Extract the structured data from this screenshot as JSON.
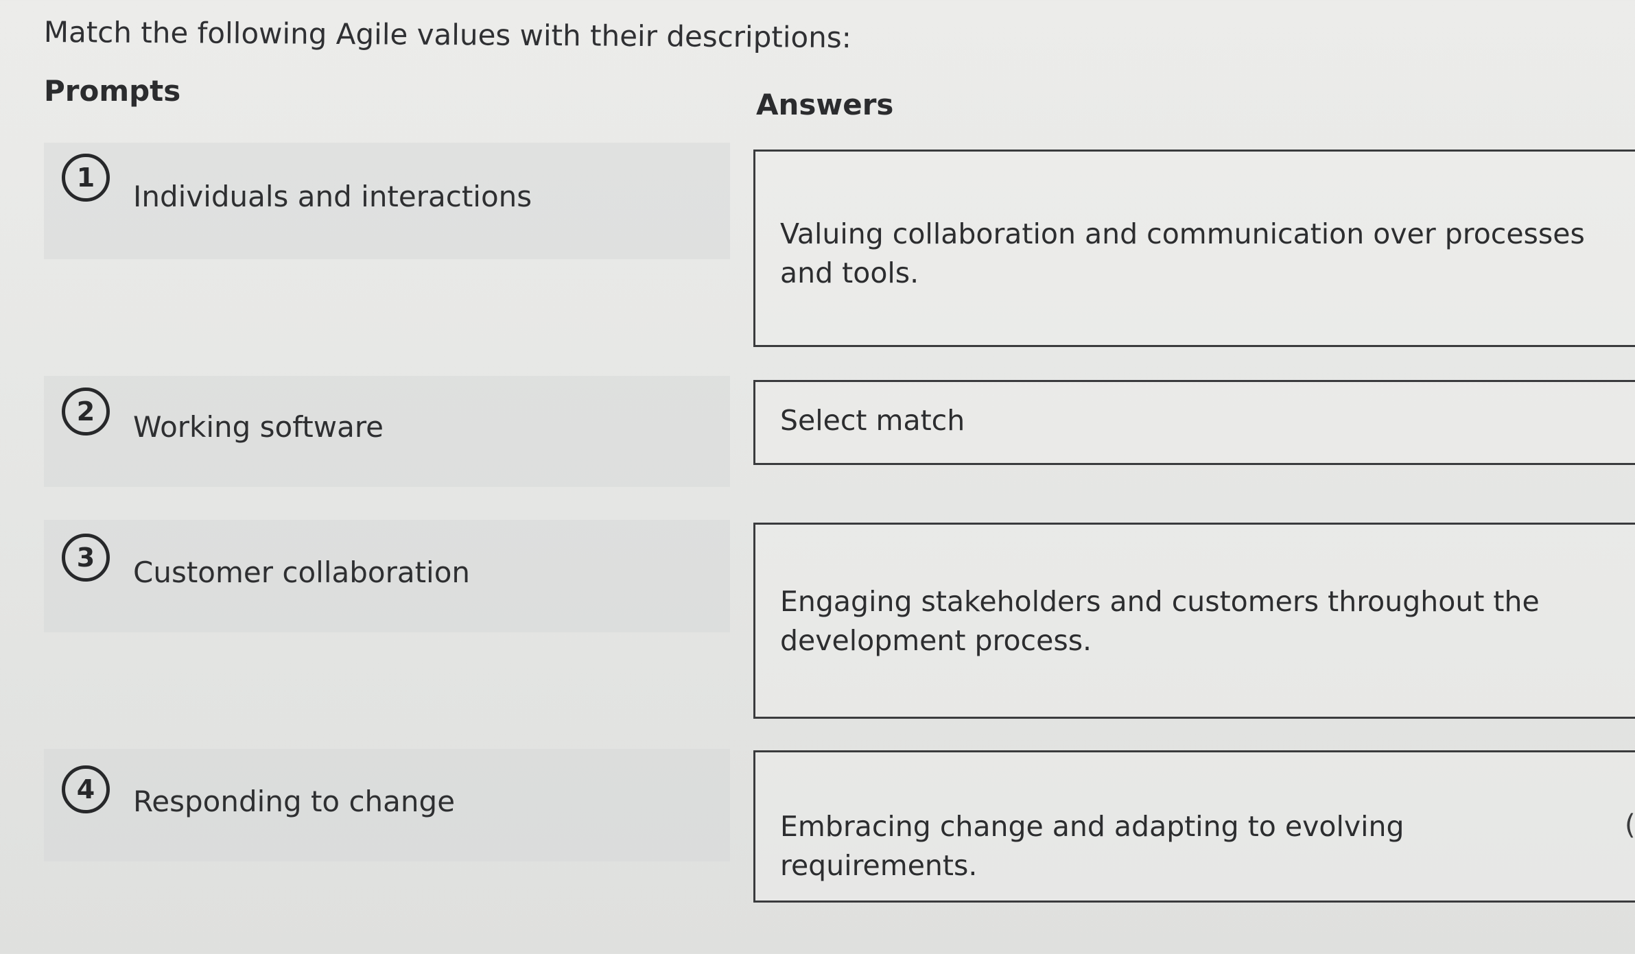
{
  "question": "Match the following Agile values with their descriptions:",
  "headings": {
    "prompts": "Prompts",
    "answers": "Answers"
  },
  "prompts": [
    {
      "number": "1",
      "label": "Individuals and interactions"
    },
    {
      "number": "2",
      "label": "Working software"
    },
    {
      "number": "3",
      "label": "Customer collaboration"
    },
    {
      "number": "4",
      "label": "Responding to change"
    }
  ],
  "answers": [
    {
      "text": "Valuing collaboration and communication over processes and tools."
    },
    {
      "text": "Select match"
    },
    {
      "text": "Engaging stakeholders and customers throughout the development process."
    },
    {
      "text": "Embracing change and adapting to evolving requirements."
    }
  ],
  "edge_glyph": "("
}
